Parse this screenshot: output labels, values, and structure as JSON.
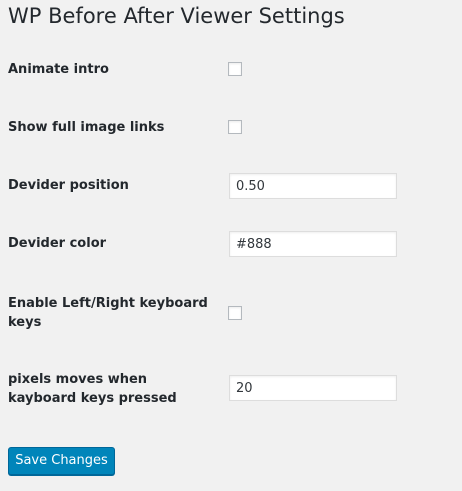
{
  "page": {
    "title": "WP Before After Viewer Settings"
  },
  "settings": {
    "animate_intro": {
      "label": "Animate intro",
      "checked": false
    },
    "show_full_image_links": {
      "label": "Show full image links",
      "checked": false
    },
    "devider_position": {
      "label": "Devider position",
      "value": "0.50"
    },
    "devider_color": {
      "label": "Devider color",
      "value": "#888"
    },
    "enable_keyboard_keys": {
      "label": "Enable Left/Right keyboard keys",
      "checked": false
    },
    "pixels_moves": {
      "label": "pixels moves when kayboard keys pressed",
      "value": "20"
    }
  },
  "actions": {
    "save_label": "Save Changes"
  },
  "colors": {
    "background": "#f1f1f1",
    "primary_button": "#0085ba",
    "text": "#23282d"
  }
}
